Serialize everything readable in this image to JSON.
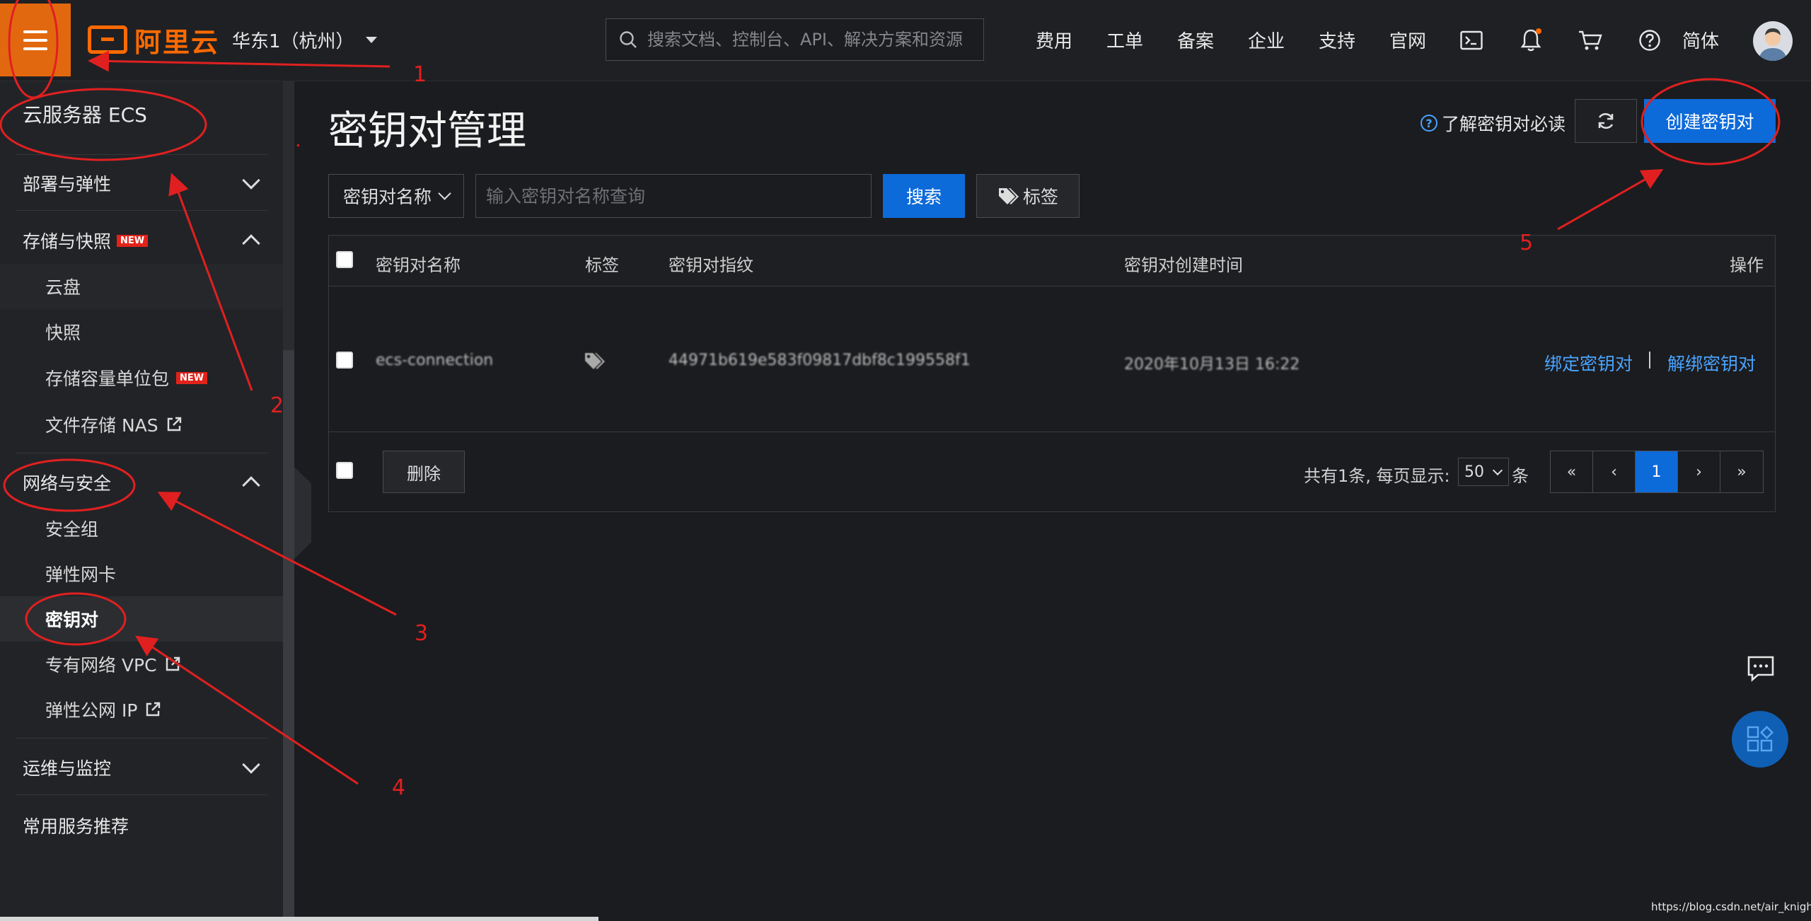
{
  "topbar": {
    "logo_text": "阿里云",
    "region": "华东1（杭州）",
    "search_placeholder": "搜索文档、控制台、API、解决方案和资源",
    "nav": [
      "费用",
      "工单",
      "备案",
      "企业",
      "支持",
      "官网"
    ],
    "icons": [
      "terminal-icon",
      "bell-icon",
      "cart-icon",
      "help-icon"
    ],
    "language": "简体"
  },
  "sidebar": {
    "title": "云服务器 ECS",
    "groups": [
      {
        "label": "部署与弹性",
        "expanded": false
      },
      {
        "label": "存储与快照",
        "badge": "NEW",
        "expanded": true,
        "items": [
          {
            "label": "云盘"
          },
          {
            "label": "快照"
          },
          {
            "label": "存储容量单位包",
            "badge": "NEW"
          },
          {
            "label": "文件存储 NAS",
            "external": true
          }
        ]
      },
      {
        "label": "网络与安全",
        "expanded": true,
        "items": [
          {
            "label": "安全组"
          },
          {
            "label": "弹性网卡"
          },
          {
            "label": "密钥对",
            "active": true
          },
          {
            "label": "专有网络 VPC",
            "external": true
          },
          {
            "label": "弹性公网 IP",
            "external": true
          }
        ]
      },
      {
        "label": "运维与监控",
        "expanded": false
      },
      {
        "label": "常用服务推荐"
      }
    ]
  },
  "main": {
    "title": "密钥对管理",
    "help_link": "了解密钥对必读",
    "create_button": "创建密钥对",
    "filter": {
      "select_value": "密钥对名称",
      "input_placeholder": "输入密钥对名称查询",
      "search_button": "搜索",
      "tag_button": "标签"
    },
    "table": {
      "columns": [
        "密钥对名称",
        "标签",
        "密钥对指纹",
        "密钥对创建时间",
        "操作"
      ],
      "rows": [
        {
          "name": "ecs-connection",
          "fingerprint": "44971b619e583f09817dbf8c199558f1",
          "created": "2020年10月13日 16:22",
          "actions": [
            "绑定密钥对",
            "解绑密钥对"
          ]
        }
      ]
    },
    "footer": {
      "delete_button": "删除",
      "total_text": "共有1条, 每页显示:",
      "page_size": "50",
      "page_unit": "条",
      "pager": [
        "«",
        "‹",
        "1",
        "›",
        "»"
      ]
    }
  },
  "annotations": [
    "1",
    "2",
    "3",
    "4",
    "5"
  ],
  "watermark": "https://blog.csdn.net/air_knight",
  "colors": {
    "accent": "#0d6ad9",
    "brand": "#ff6a00",
    "annotation": "#e02020",
    "link": "#4aa3ff"
  }
}
